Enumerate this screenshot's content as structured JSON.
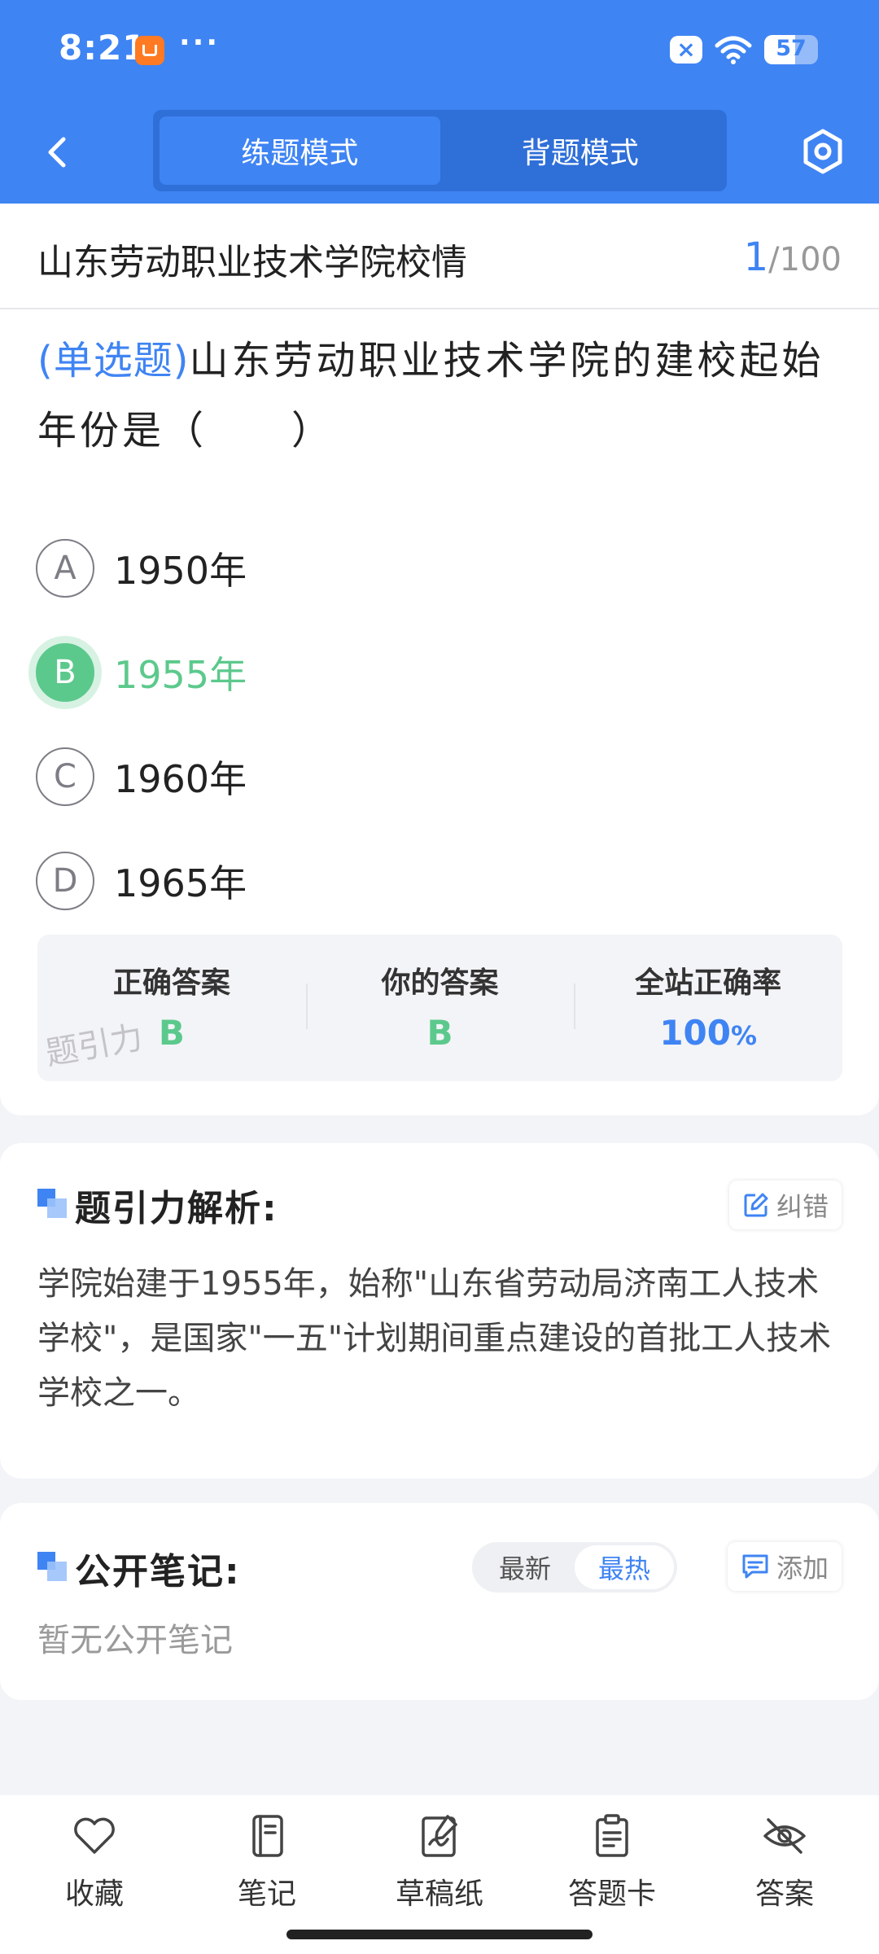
{
  "status_bar": {
    "time": "8:21",
    "dots": "···",
    "battery": "57",
    "battery_level": 0.57
  },
  "nav": {
    "tabs": [
      {
        "label": "练题模式",
        "active": true
      },
      {
        "label": "背题模式",
        "active": false
      }
    ]
  },
  "question": {
    "section_title": "山东劳动职业技术学院校情",
    "current": "1",
    "total": "/100",
    "type": "(单选题)",
    "stem": "山东劳动职业技术学院的建校起始年份是（　　）",
    "options": [
      {
        "letter": "A",
        "text": "1950年"
      },
      {
        "letter": "B",
        "text": "1955年"
      },
      {
        "letter": "C",
        "text": "1960年"
      },
      {
        "letter": "D",
        "text": "1965年"
      }
    ],
    "selected_option": "B"
  },
  "answer_summary": {
    "correct_label": "正确答案",
    "correct_value": "B",
    "yours_label": "你的答案",
    "yours_value": "B",
    "rate_label": "全站正确率",
    "rate_value": "100",
    "rate_unit": "%",
    "watermark": "题引力"
  },
  "analysis": {
    "title": "题引力解析:",
    "report_label": "纠错",
    "text": "学院始建于1955年，始称\"山东省劳动局济南工人技术学校\"，是国家\"一五\"计划期间重点建设的首批工人技术学校之一。"
  },
  "notes": {
    "title": "公开笔记:",
    "sort_latest": "最新",
    "sort_hot": "最热",
    "add_label": "添加",
    "empty_text": "暂无公开笔记"
  },
  "toolbar": {
    "items": [
      {
        "label": "收藏",
        "icon": "heart-icon"
      },
      {
        "label": "笔记",
        "icon": "notebook-icon"
      },
      {
        "label": "草稿纸",
        "icon": "draft-paper-icon"
      },
      {
        "label": "答题卡",
        "icon": "answer-card-icon"
      },
      {
        "label": "答案",
        "icon": "eye-off-icon"
      }
    ]
  },
  "colors": {
    "primary": "#3f84f3",
    "correct": "#5cc98c",
    "background": "#f3f4f7"
  }
}
